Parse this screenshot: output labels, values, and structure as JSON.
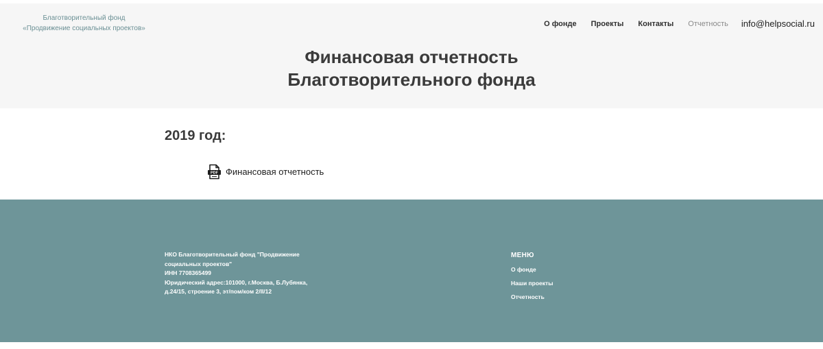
{
  "header": {
    "logo_line1": "Благотворительный фонд",
    "logo_line2": "«Продвижение социальных проектов»",
    "nav": [
      {
        "label": "О фонде"
      },
      {
        "label": "Проекты"
      },
      {
        "label": "Контакты"
      },
      {
        "label": "Отчетность"
      }
    ],
    "email": "info@helpsocial.ru"
  },
  "hero": {
    "title_line1": "Финансовая отчетность",
    "title_line2": "Благотворительного фонда"
  },
  "content": {
    "year_heading": "2019 год:",
    "document_label": "Финансовая отчетность",
    "document_icon": "pdf-file-icon",
    "pdf_badge": "PDF"
  },
  "footer": {
    "org_line1": "НКО Благотворительный фонд \"Продвижение",
    "org_line2": "социальных проектов\"",
    "org_line3": "ИНН 7708365499",
    "org_line4": "Юридический адрес:101000, г.Москва, Б.Лубянка,",
    "org_line5": "д.24/15, строение 3, эт/пом/ком 2/II/12",
    "menu_title": "МЕНЮ",
    "menu": [
      {
        "label": "О фонде"
      },
      {
        "label": "Наши проекты"
      },
      {
        "label": "Отчетность"
      }
    ]
  },
  "colors": {
    "hero_bg": "#f6f6f6",
    "footer_bg": "#6e9599",
    "logo_text": "#6a8f94",
    "heading_text": "#3b3b3b"
  }
}
